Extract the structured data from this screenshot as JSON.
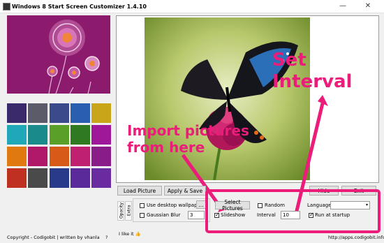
{
  "window": {
    "title": "Windows 8 Start Screen Customizer 1.4.10",
    "minimize": "—",
    "close": "✕"
  },
  "buttons": {
    "load_picture": "Load Picture",
    "apply_save": "Apply & Save",
    "hide": "Hide",
    "exit": "Exit",
    "select_pictures": "Select Pictures",
    "browse": "..."
  },
  "tabs": {
    "opacity": "Opacity",
    "extra": "Extra"
  },
  "options": {
    "use_desktop_wallpaper": "Use desktop wallpaper",
    "gaussian_blur": "Gaussian Blur",
    "gaussian_blur_value": "3",
    "random": "Random",
    "slideshow": "Slideshow",
    "interval_label": "Interval",
    "interval_value": "10",
    "run_at_startup": "Run at startup",
    "language_label": "Language",
    "language_value": ""
  },
  "footer": {
    "copyright": "Copyright - Codigobit | written by vhanla",
    "help": "?",
    "like": "I like it",
    "url": "http://apps.codigobit.info"
  },
  "annotations": {
    "set_interval_line1": "Set",
    "set_interval_line2": "Interval",
    "import_line1": "Import pictures",
    "import_line2": "from here"
  },
  "colors": {
    "annotation": "#ec1c7a",
    "preview_bg": "#8d1b6d"
  }
}
